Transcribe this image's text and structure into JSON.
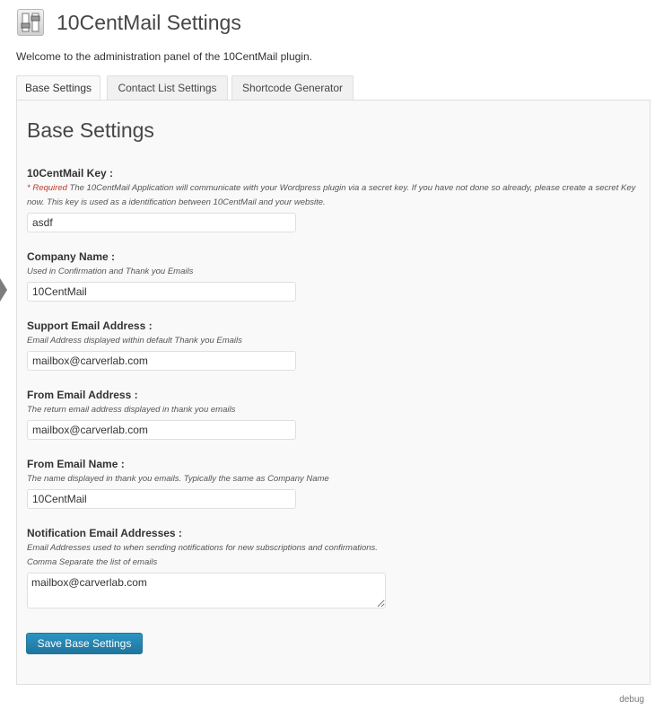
{
  "header": {
    "title": "10CentMail Settings",
    "icon": "plugin-settings-icon"
  },
  "welcome_text": "Welcome to the administration panel of the 10CentMail plugin.",
  "tabs": [
    {
      "label": "Base Settings",
      "active": true
    },
    {
      "label": "Contact List Settings",
      "active": false
    },
    {
      "label": "Shortcode Generator",
      "active": false
    }
  ],
  "panel": {
    "heading": "Base Settings",
    "fields": [
      {
        "label": "10CentMail Key :",
        "required_text": "* Required",
        "description": "The 10CentMail Application will communicate with your Wordpress plugin via a secret key. If you have not done so already, please create a secret Key now. This key is used as a identification between 10CentMail and your website.",
        "value": "asdf"
      },
      {
        "label": "Company Name :",
        "description": "Used in Confirmation and Thank you Emails",
        "value": "10CentMail"
      },
      {
        "label": "Support Email Address :",
        "description": "Email Address displayed within default Thank you Emails",
        "value": "mailbox@carverlab.com"
      },
      {
        "label": "From Email Address :",
        "description": "The return email address displayed in thank you emails",
        "value": "mailbox@carverlab.com"
      },
      {
        "label": "From Email Name :",
        "description": "The name displayed in thank you emails. Typically the same as Company Name",
        "value": "10CentMail"
      },
      {
        "label": "Notification Email Addresses :",
        "description": "Email Addresses used to when sending notifications for new subscriptions and confirmations.",
        "description2": "Comma Separate the list of emails",
        "value": "mailbox@carverlab.com"
      }
    ],
    "save_label": "Save Base Settings"
  },
  "footer": {
    "debug_label": "debug"
  },
  "colors": {
    "accent": "#21759b",
    "required": "#c0392b",
    "panel_bg": "#f9f9f9"
  }
}
